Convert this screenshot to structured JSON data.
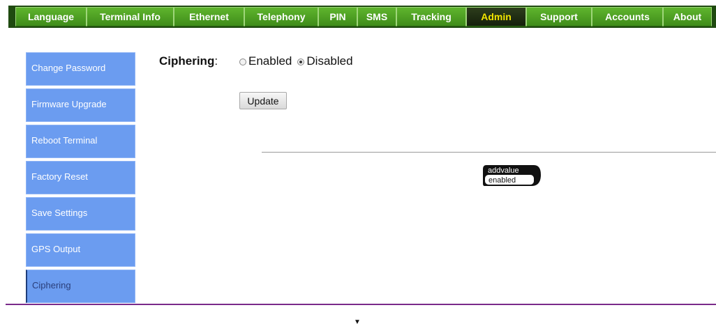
{
  "topnav": {
    "tabs": [
      {
        "label": "Language"
      },
      {
        "label": "Terminal Info"
      },
      {
        "label": "Ethernet"
      },
      {
        "label": "Telephony"
      },
      {
        "label": "PIN"
      },
      {
        "label": "SMS"
      },
      {
        "label": "Tracking"
      },
      {
        "label": "Admin",
        "active": true
      },
      {
        "label": "Support"
      },
      {
        "label": "Accounts"
      },
      {
        "label": "About"
      }
    ]
  },
  "sidebar": {
    "items": [
      {
        "label": "Change Password"
      },
      {
        "label": "Firmware Upgrade"
      },
      {
        "label": "Reboot Terminal"
      },
      {
        "label": "Factory Reset"
      },
      {
        "label": "Save Settings"
      },
      {
        "label": "GPS Output"
      },
      {
        "label": "Ciphering",
        "active": true
      }
    ]
  },
  "main": {
    "field_label": "Ciphering",
    "colon": ":",
    "options": [
      {
        "label": "Enabled",
        "checked": false
      },
      {
        "label": "Disabled",
        "checked": true
      }
    ],
    "update_label": "Update"
  },
  "logo": {
    "line1": "addvalue",
    "line2": "enabled"
  },
  "footer": {
    "arrow": "▼"
  },
  "colors": {
    "nav_green": "#4ca021",
    "active_tab_text": "#f2e600",
    "sidebar_blue": "#6b9cf0",
    "bottom_line": "#7a2a8a"
  }
}
